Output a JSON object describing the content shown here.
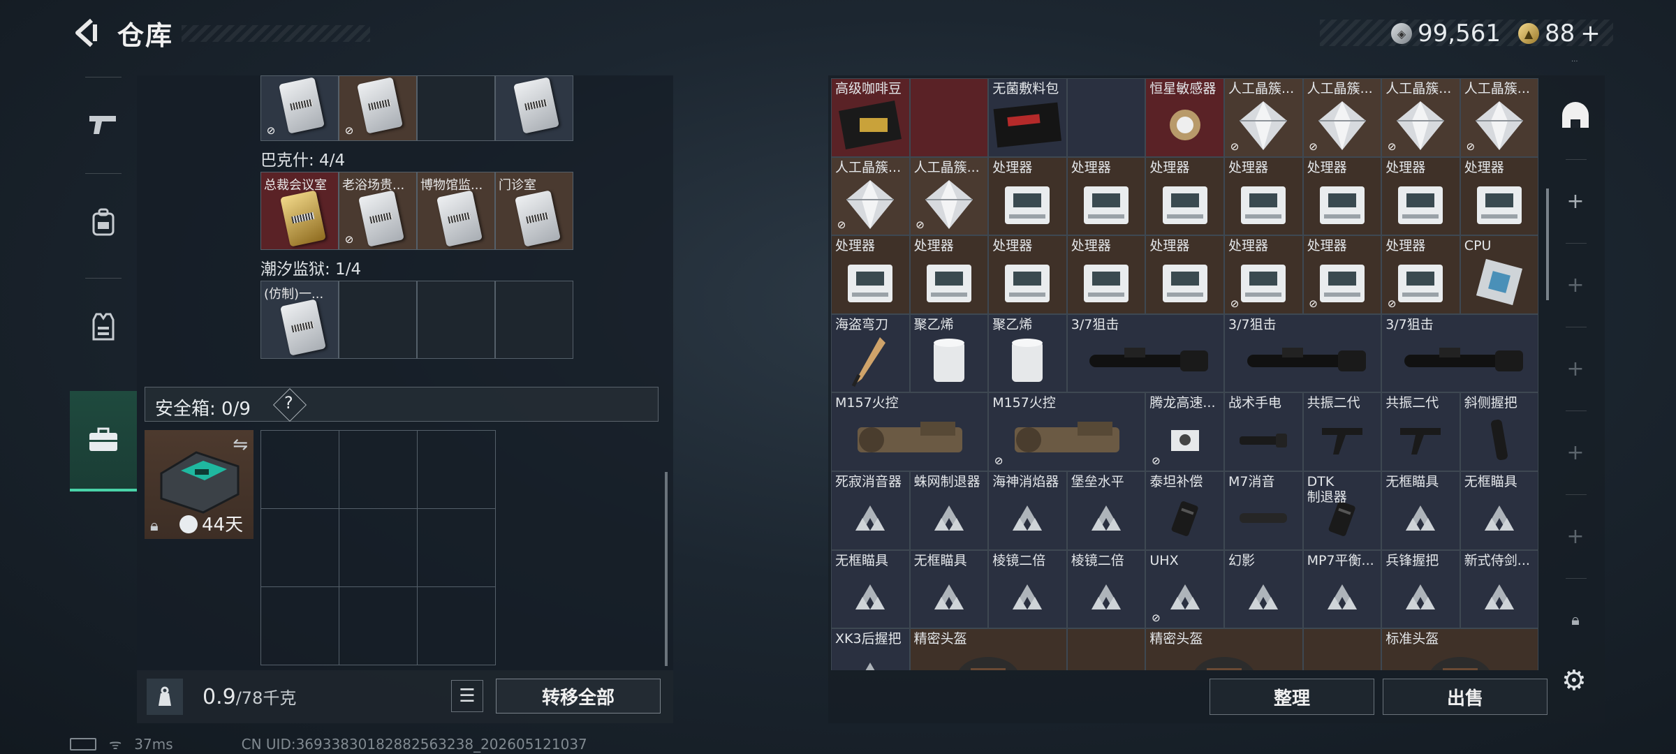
{
  "header": {
    "title": "仓库",
    "back_icon": "back-arrow-icon"
  },
  "currency": {
    "silver": "99,561",
    "gold": "88",
    "add": "+",
    "corner_text": "..."
  },
  "left_nav": [
    "pistol-icon",
    "backpack-icon",
    "vest-icon",
    "toolbox-icon"
  ],
  "keycards": {
    "group1_label": "巴克什: 4/4",
    "group1_items": [
      "总裁会议室",
      "老浴场贵...",
      "博物馆监...",
      "门诊室"
    ],
    "group2_label": "潮汐监狱: 1/4",
    "group2_items": [
      "(仿制)一..."
    ]
  },
  "safe": {
    "label": "安全箱: 0/9",
    "help": "?",
    "timer": "44天"
  },
  "weight": {
    "current": "0.9",
    "max": "/78千克"
  },
  "buttons": {
    "transfer_all": "转移全部",
    "sort": "整理",
    "sell": "出售"
  },
  "inventory": [
    {
      "name": "高级咖啡豆",
      "bg": "#5a2226",
      "icon": "coffee"
    },
    {
      "name": "",
      "bg": "#5a2226",
      "icon": "none"
    },
    {
      "name": "无菌敷料包",
      "bg": "#2a3040",
      "icon": "pack"
    },
    {
      "name": "",
      "bg": "#2a3040",
      "icon": "none"
    },
    {
      "name": "恒星敏感器",
      "bg": "#5a2226",
      "icon": "sensor"
    },
    {
      "name": "人工晶簇...",
      "bg": "#4a3a30",
      "icon": "crystal",
      "lock": true
    },
    {
      "name": "人工晶簇...",
      "bg": "#4a3a30",
      "icon": "crystal",
      "lock": true
    },
    {
      "name": "人工晶簇...",
      "bg": "#4a3a30",
      "icon": "crystal",
      "lock": true
    },
    {
      "name": "人工晶簇...",
      "bg": "#4a3a30",
      "icon": "crystal",
      "lock": true
    },
    {
      "name": "人工晶簇...",
      "bg": "#4a3a30",
      "icon": "crystal",
      "lock": true
    },
    {
      "name": "人工晶簇...",
      "bg": "#4a3a30",
      "icon": "crystal",
      "lock": true
    },
    {
      "name": "处理器",
      "bg": "#3f3128",
      "icon": "cpu-box"
    },
    {
      "name": "处理器",
      "bg": "#3f3128",
      "icon": "cpu-box"
    },
    {
      "name": "处理器",
      "bg": "#3f3128",
      "icon": "cpu-box"
    },
    {
      "name": "处理器",
      "bg": "#3f3128",
      "icon": "cpu-box"
    },
    {
      "name": "处理器",
      "bg": "#3f3128",
      "icon": "cpu-box"
    },
    {
      "name": "处理器",
      "bg": "#3f3128",
      "icon": "cpu-box"
    },
    {
      "name": "处理器",
      "bg": "#3f3128",
      "icon": "cpu-box"
    },
    {
      "name": "处理器",
      "bg": "#3f3128",
      "icon": "cpu-box"
    },
    {
      "name": "处理器",
      "bg": "#3f3128",
      "icon": "cpu-box"
    },
    {
      "name": "处理器",
      "bg": "#3f3128",
      "icon": "cpu-box"
    },
    {
      "name": "处理器",
      "bg": "#3f3128",
      "icon": "cpu-box"
    },
    {
      "name": "处理器",
      "bg": "#3f3128",
      "icon": "cpu-box"
    },
    {
      "name": "处理器",
      "bg": "#3f3128",
      "icon": "cpu-box",
      "lock": true
    },
    {
      "name": "处理器",
      "bg": "#3f3128",
      "icon": "cpu-box",
      "lock": true
    },
    {
      "name": "处理器",
      "bg": "#3f3128",
      "icon": "cpu-box",
      "lock": true
    },
    {
      "name": "CPU",
      "bg": "#3f3128",
      "icon": "chip"
    },
    {
      "name": "海盗弯刀",
      "bg": "#2a3040",
      "icon": "knife"
    },
    {
      "name": "聚乙烯",
      "bg": "#2a3040",
      "icon": "roll"
    },
    {
      "name": "聚乙烯",
      "bg": "#2a3040",
      "icon": "roll"
    },
    {
      "name": "3/7狙击",
      "bg": "#2a3040",
      "icon": "scope",
      "span": 2
    },
    {
      "name": "3/7狙击",
      "bg": "#2a3040",
      "icon": "scope",
      "span": 2
    },
    {
      "name": "3/7狙击",
      "bg": "#2a3040",
      "icon": "scope",
      "span": 2
    },
    {
      "name": "M157火控",
      "bg": "#2a3040",
      "icon": "firecontrol",
      "span": 2
    },
    {
      "name": "M157火控",
      "bg": "#2a3040",
      "icon": "firecontrol",
      "span": 2,
      "lock": true
    },
    {
      "name": "腾龙高速...",
      "bg": "#2a3040",
      "icon": "mount",
      "lock": true
    },
    {
      "name": "战术手电",
      "bg": "#2a3040",
      "icon": "flashlight"
    },
    {
      "name": "共振二代",
      "bg": "#2a3040",
      "icon": "grip"
    },
    {
      "name": "共振二代",
      "bg": "#2a3040",
      "icon": "grip"
    },
    {
      "name": "斜侧握把",
      "bg": "#2a3040",
      "icon": "vgrip"
    },
    {
      "name": "死寂消音器",
      "bg": "#2a3040",
      "icon": "tri"
    },
    {
      "name": "蛛网制退器",
      "bg": "#2a3040",
      "icon": "tri"
    },
    {
      "name": "海神消焰器",
      "bg": "#2a3040",
      "icon": "tri"
    },
    {
      "name": "堡垒水平",
      "bg": "#2a3040",
      "icon": "tri"
    },
    {
      "name": "泰坦补偿",
      "bg": "#2a3040",
      "icon": "brake"
    },
    {
      "name": "M7消音",
      "bg": "#2a3040",
      "icon": "silencer"
    },
    {
      "name": "DTK\n制退器",
      "bg": "#2a3040",
      "icon": "brake"
    },
    {
      "name": "无框瞄具",
      "bg": "#2a3040",
      "icon": "tri"
    },
    {
      "name": "无框瞄具",
      "bg": "#2a3040",
      "icon": "tri"
    },
    {
      "name": "无框瞄具",
      "bg": "#2a3040",
      "icon": "tri"
    },
    {
      "name": "无框瞄具",
      "bg": "#2a3040",
      "icon": "tri"
    },
    {
      "name": "棱镜二倍",
      "bg": "#2a3040",
      "icon": "tri"
    },
    {
      "name": "棱镜二倍",
      "bg": "#2a3040",
      "icon": "tri"
    },
    {
      "name": "UHX",
      "bg": "#2a3040",
      "icon": "tri",
      "lock": true
    },
    {
      "name": "幻影",
      "bg": "#2a3040",
      "icon": "tri"
    },
    {
      "name": "MP7平衡...",
      "bg": "#2a3040",
      "icon": "tri"
    },
    {
      "name": "兵锋握把",
      "bg": "#2a3040",
      "icon": "tri"
    },
    {
      "name": "新式侍剑...",
      "bg": "#2a3040",
      "icon": "tri"
    },
    {
      "name": "XK3后握把",
      "bg": "#2a3040",
      "icon": "tri"
    },
    {
      "name": "精密头盔",
      "bg": "#3f3128",
      "icon": "helmet",
      "span": 2
    },
    {
      "name": "",
      "bg": "#3f3128",
      "icon": "none"
    },
    {
      "name": "精密头盔",
      "bg": "#3f3128",
      "icon": "helmet",
      "span": 2
    },
    {
      "name": "",
      "bg": "#3f3128",
      "icon": "none"
    },
    {
      "name": "标准头盔",
      "bg": "#3f3128",
      "icon": "helmet",
      "span": 2
    }
  ],
  "right_side": [
    "helmet-icon",
    "plus-icon",
    "plus-icon",
    "plus-icon",
    "plus-icon",
    "plus-icon",
    "lock-icon"
  ],
  "status": {
    "ping": "37ms",
    "uid": "CN UID:3693383018288256323​8_202605121037"
  }
}
